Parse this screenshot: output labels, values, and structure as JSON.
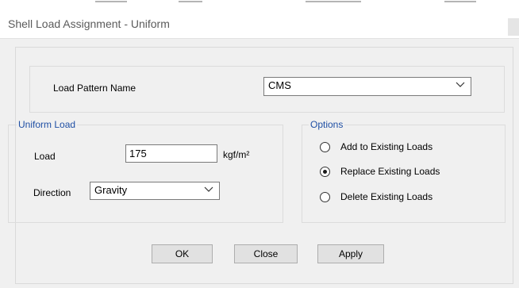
{
  "window": {
    "title": "Shell Load Assignment - Uniform"
  },
  "load_pattern": {
    "label": "Load Pattern Name",
    "selected": "CMS"
  },
  "uniform_load": {
    "legend": "Uniform Load",
    "load_label": "Load",
    "load_value": "175",
    "unit": "kgf/m²",
    "direction_label": "Direction",
    "direction_selected": "Gravity"
  },
  "options": {
    "legend": "Options",
    "items": [
      {
        "label": "Add to Existing Loads",
        "selected": false
      },
      {
        "label": "Replace Existing Loads",
        "selected": true
      },
      {
        "label": "Delete Existing Loads",
        "selected": false
      }
    ]
  },
  "buttons": {
    "ok": "OK",
    "close": "Close",
    "apply": "Apply"
  },
  "icons": {
    "dropdown": "chevron-down-icon"
  }
}
